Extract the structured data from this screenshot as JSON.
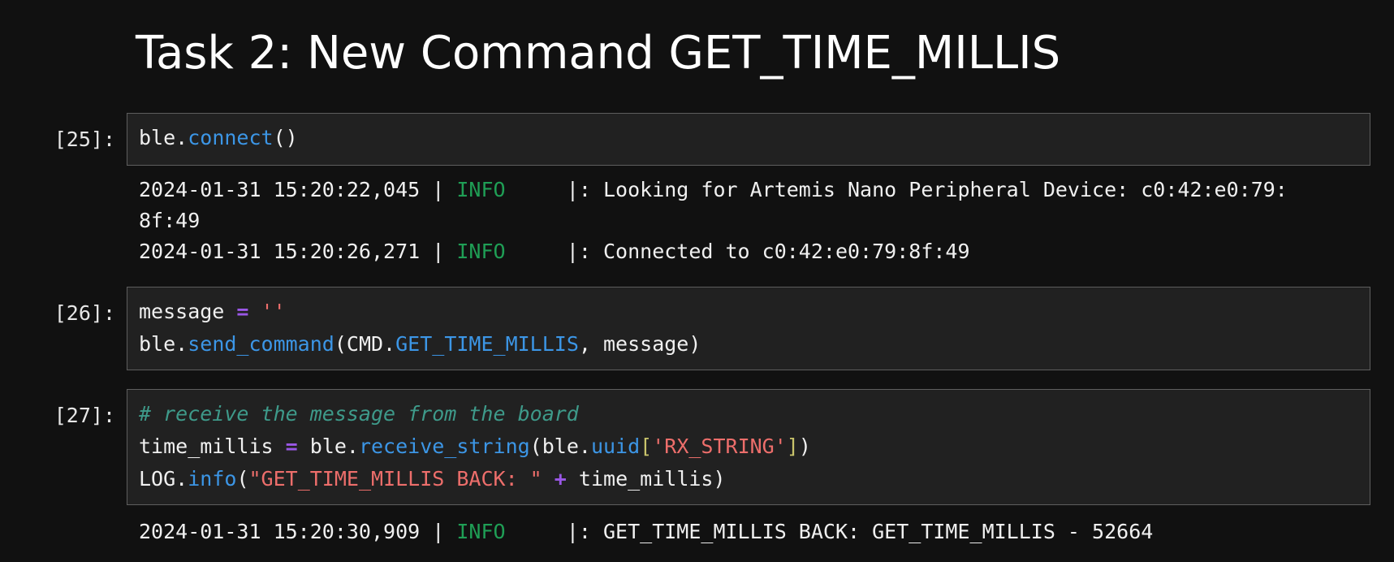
{
  "heading": "Task 2: New Command GET_TIME_MILLIS",
  "cells": [
    {
      "prompt": "[25]:",
      "code": {
        "obj": "ble",
        "dot": ".",
        "method": "connect",
        "parens": "()"
      },
      "output": [
        {
          "timestamp": "2024-01-31 15:20:22,045 | ",
          "level": "INFO",
          "sep": "     |: ",
          "message": "Looking for Artemis Nano Peripheral Device: c0:42:e0:79:",
          "continuation": "8f:49"
        },
        {
          "timestamp": "2024-01-31 15:20:26,271 | ",
          "level": "INFO",
          "sep": "     |: ",
          "message": "Connected to c0:42:e0:79:8f:49"
        }
      ]
    },
    {
      "prompt": "[26]:",
      "code": {
        "line1": {
          "var": "message ",
          "op": "=",
          "space": " ",
          "str": "''"
        },
        "line2": {
          "obj": "ble",
          "dot": ".",
          "method": "send_command",
          "open": "(CMD.",
          "const": "GET_TIME_MILLIS",
          "rest": ", message)"
        }
      }
    },
    {
      "prompt": "[27]:",
      "code": {
        "comment": "# receive the message from the board",
        "line2": {
          "var": "time_millis ",
          "op": "=",
          "mid": " ble.",
          "method": "receive_string",
          "open": "(ble.",
          "attr": "uuid",
          "lbr": "[",
          "str": "'RX_STRING'",
          "rbr": "]",
          "close": ")"
        },
        "line3": {
          "obj": "LOG",
          "dot": ".",
          "method": "info",
          "open": "(",
          "str": "\"GET_TIME_MILLIS BACK: \"",
          "space": " ",
          "op": "+",
          "rest": " time_millis)"
        }
      },
      "output": [
        {
          "timestamp": "2024-01-31 15:20:30,909 | ",
          "level": "INFO",
          "sep": "     |: ",
          "message": "GET_TIME_MILLIS BACK: GET_TIME_MILLIS - 52664"
        }
      ]
    }
  ]
}
